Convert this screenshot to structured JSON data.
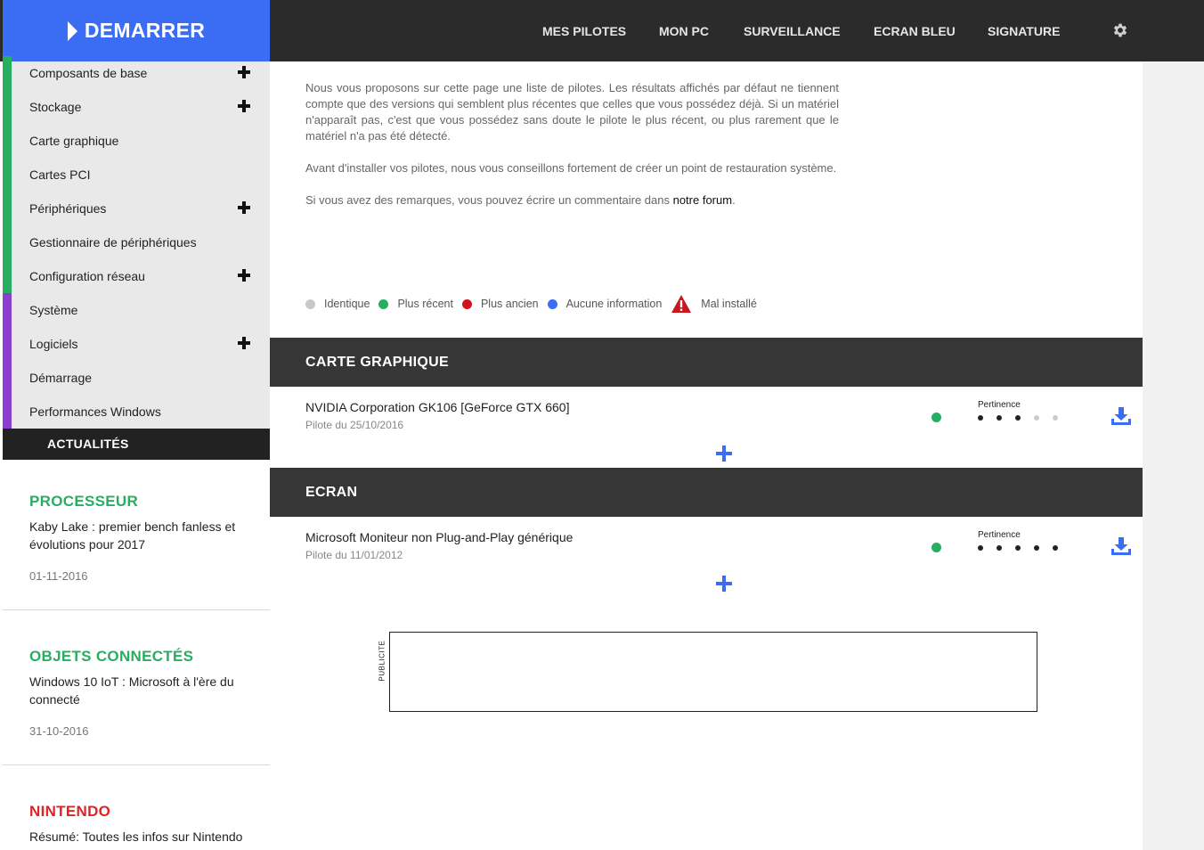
{
  "header": {
    "start_label": "DEMARRER",
    "nav": [
      "MES PILOTES",
      "MON PC",
      "SURVEILLANCE",
      "ECRAN BLEU",
      "SIGNATURE"
    ],
    "settings_icon": "gear-icon"
  },
  "sidebar": {
    "items": [
      {
        "label": "Composants de base",
        "expandable": true,
        "group_color": "#27ae60"
      },
      {
        "label": "Stockage",
        "expandable": true,
        "group_color": "#27ae60"
      },
      {
        "label": "Carte graphique",
        "expandable": false,
        "group_color": "#27ae60"
      },
      {
        "label": "Cartes PCI",
        "expandable": false,
        "group_color": "#27ae60"
      },
      {
        "label": "Périphériques",
        "expandable": true,
        "group_color": "#27ae60"
      },
      {
        "label": "Gestionnaire de périphériques",
        "expandable": false,
        "group_color": "#27ae60"
      },
      {
        "label": "Configuration réseau",
        "expandable": true,
        "group_color": "#27ae60"
      },
      {
        "label": "Système",
        "expandable": false,
        "group_color": "#8a3fd1"
      },
      {
        "label": "Logiciels",
        "expandable": true,
        "group_color": "#8a3fd1"
      },
      {
        "label": "Démarrage",
        "expandable": false,
        "group_color": "#8a3fd1"
      },
      {
        "label": "Performances Windows",
        "expandable": false,
        "group_color": "#8a3fd1"
      }
    ],
    "news_header": "ACTUALITÉS",
    "news": [
      {
        "category": "PROCESSEUR",
        "color": "#27ae60",
        "title": "Kaby Lake : premier bench fanless et évolutions pour 2017",
        "date": "01-11-2016"
      },
      {
        "category": "OBJETS CONNECTÉS",
        "color": "#27ae60",
        "title": "Windows 10 IoT : Microsoft à l'ère du connecté",
        "date": "31-10-2016"
      },
      {
        "category": "NINTENDO",
        "color": "#e02424",
        "title": "Résumé: Toutes les infos sur Nintendo Switch",
        "date": ""
      }
    ]
  },
  "intro": {
    "p1": "Nous vous proposons sur cette page une liste de pilotes. Les résultats affichés par défaut ne tiennent compte que des versions qui semblent plus récentes que celles que vous possédez déjà. Si un matériel n'apparaît pas, c'est que vous possédez sans doute le pilote le plus récent, ou plus rarement que le matériel n'a pas été détecté.",
    "p2": "Avant d'installer vos pilotes, nous vous conseillons fortement de créer un point de restauration système.",
    "p3_before": "Si vous avez des remarques, vous pouvez écrire un commentaire dans ",
    "p3_link": "notre forum",
    "p3_after": "."
  },
  "legend": [
    {
      "label": "Identique",
      "color": "#c8c8c8"
    },
    {
      "label": "Plus récent",
      "color": "#27ae60"
    },
    {
      "label": "Plus ancien",
      "color": "#d0141d"
    },
    {
      "label": "Aucune information",
      "color": "#3a6cf4"
    },
    {
      "label": "Mal installé",
      "icon": "warning-icon"
    }
  ],
  "sections": [
    {
      "title": "CARTE GRAPHIQUE",
      "driver": {
        "name": "NVIDIA Corporation GK106 [GeForce GTX 660]",
        "date": "Pilote du 25/10/2016",
        "status_color": "#27ae60",
        "pertinence_label": "Pertinence",
        "pertinence": 3,
        "pertinence_max": 5
      }
    },
    {
      "title": "ECRAN",
      "driver": {
        "name": "Microsoft Moniteur non Plug-and-Play générique",
        "date": "Pilote du 11/01/2012",
        "status_color": "#27ae60",
        "pertinence_label": "Pertinence",
        "pertinence": 5,
        "pertinence_max": 5
      }
    }
  ],
  "ad": {
    "label": "PUBLICITE"
  }
}
